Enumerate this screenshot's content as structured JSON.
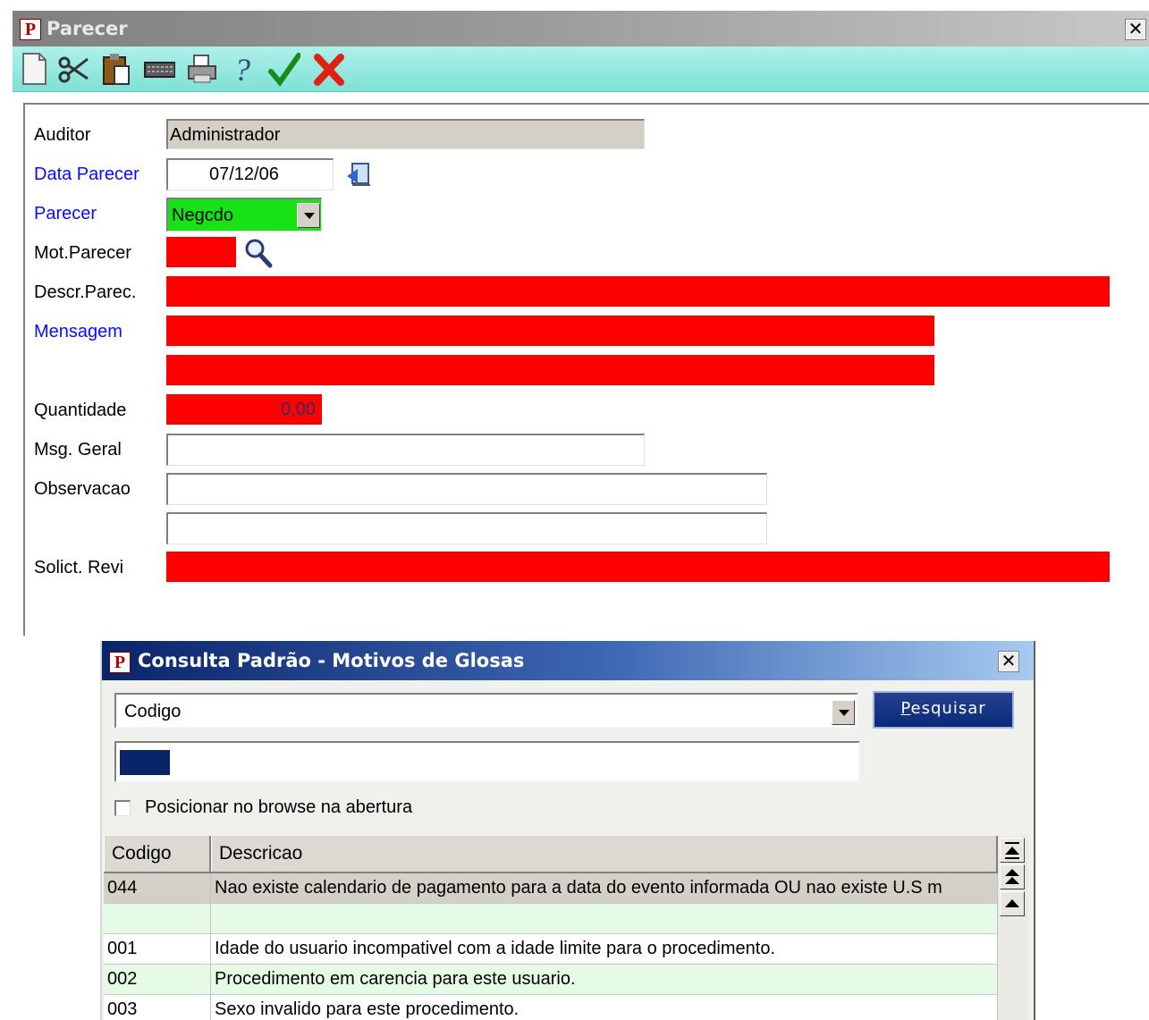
{
  "main_window": {
    "title": "Parecer",
    "toolbar": [
      "new-doc-icon",
      "cut-icon",
      "paste-icon",
      "keyboard-icon",
      "print-icon",
      "help-icon",
      "confirm-check-icon",
      "cancel-x-icon"
    ]
  },
  "form": {
    "auditor": {
      "label": "Auditor",
      "value": "Administrador"
    },
    "data_parecer": {
      "label": "Data Parecer",
      "value": "07/12/06"
    },
    "parecer": {
      "label": "Parecer",
      "value": "Negcdo"
    },
    "mot_parecer": {
      "label": "Mot.Parecer",
      "value": ""
    },
    "descr_parec": {
      "label": "Descr.Parec.",
      "value": ""
    },
    "mensagem": {
      "label": "Mensagem",
      "value_1": "",
      "value_2": ""
    },
    "quantidade": {
      "label": "Quantidade",
      "value": "0,00"
    },
    "msg_geral": {
      "label": "Msg. Geral",
      "value": ""
    },
    "observacao": {
      "label": "Observacao",
      "value_1": "",
      "value_2": ""
    },
    "solict_revi": {
      "label": "Solict. Revi",
      "value": ""
    }
  },
  "lookup": {
    "title": "Consulta Padrão - Motivos de Glosas",
    "search_field_selected": "Codigo",
    "search_button_accel": "P",
    "search_button_rest": "esquisar",
    "search_value": "",
    "checkbox_label": "Posicionar no browse na abertura",
    "checkbox_checked": false,
    "grid": {
      "columns": [
        "Codigo",
        "Descricao"
      ],
      "rows": [
        {
          "codigo": "044",
          "descricao": "Nao existe calendario de pagamento para a data do evento informada OU nao existe U.S m"
        },
        {
          "codigo": "",
          "descricao": ""
        },
        {
          "codigo": "001",
          "descricao": "Idade do usuario incompativel com a idade limite para o procedimento."
        },
        {
          "codigo": "002",
          "descricao": "Procedimento em carencia para este usuario."
        },
        {
          "codigo": "003",
          "descricao": "Sexo invalido para este procedimento."
        }
      ]
    }
  },
  "colors": {
    "required_field": "#ff0000",
    "parecer_field": "#16e316",
    "toolbar": "#7fe1d6",
    "selected_row": "#d4d0c8",
    "alt_row": "#e6fbe6"
  }
}
